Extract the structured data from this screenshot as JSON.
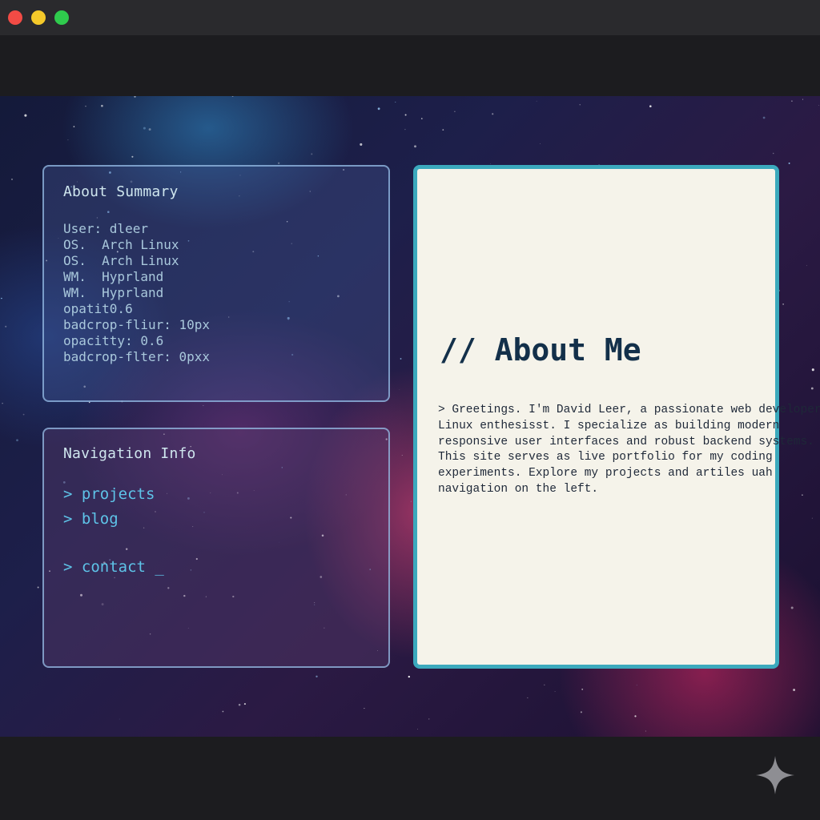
{
  "window": {
    "controls": {
      "close_color": "#f24b45",
      "minimize_color": "#f4c92a",
      "maximize_color": "#2fcb4d"
    }
  },
  "summary": {
    "title": "About Summary",
    "lines": [
      "User: dleer",
      "OS.  Arch Linux",
      "OS.  Arch Linux",
      "WM.  Hyprland",
      "WM.  Hyprland",
      "opatit0.6",
      "badcrop-fliur: 10px",
      "opacitty: 0.6",
      "badcrop-flter: 0pxx"
    ]
  },
  "navigation": {
    "title": "Navigation Info",
    "items": [
      {
        "label": "> projects"
      },
      {
        "label": "> blog"
      },
      {
        "label": "> contact"
      }
    ],
    "cursor": "_"
  },
  "about": {
    "title": "// About Me",
    "lines": [
      "> Greetings. I'm David Leer, a passionate web developer",
      "Linux enthesisst. I specialize as building modern",
      "responsive user interfaces and robust backend systems.",
      "This site serves as live portfolio for my coding",
      "experiments. Explore my projects and artiles uah",
      "navigation on the left."
    ]
  },
  "colors": {
    "accent_border": "#3ba9bd",
    "nav_link": "#5ec3e8",
    "card_background": "#f5f3ea",
    "title_text": "#13304a"
  },
  "icons": {
    "corner": "sparkle-icon"
  }
}
